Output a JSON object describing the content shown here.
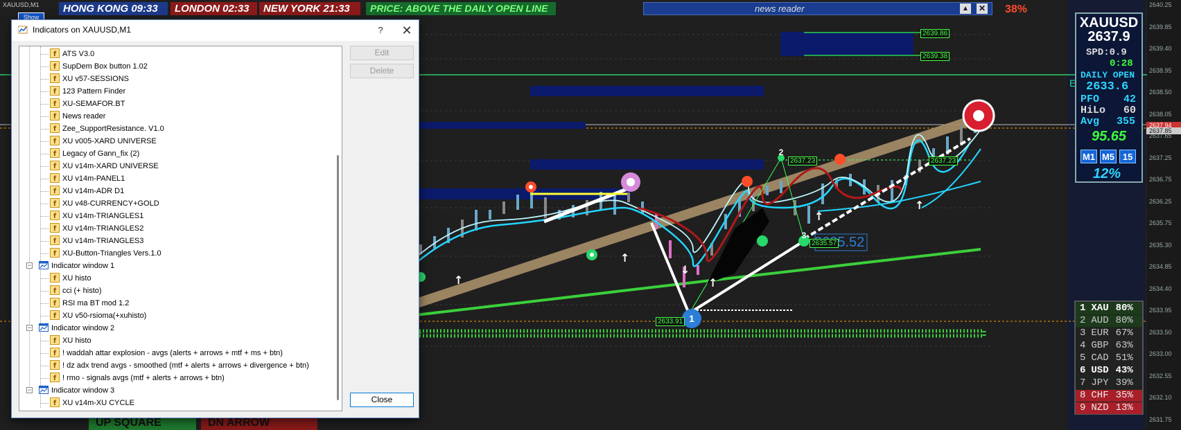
{
  "top_bar": {
    "symbol_tab": "XAUUSD,M1",
    "show_button": "Show",
    "clocks": [
      {
        "label": "HONG KONG 09:33"
      },
      {
        "label": "LONDON  02:33"
      },
      {
        "label": "NEW YORK 21:33"
      },
      {
        "label": "PRICE: ABOVE THE DAILY OPEN LINE"
      }
    ],
    "news_reader": "news reader",
    "news_up": "▲",
    "news_close": "✕",
    "percent": "38%"
  },
  "chart": {
    "price_ticks": [
      "2640.25",
      "2639.85",
      "2639.40",
      "2638.95",
      "2638.50",
      "2638.05",
      "2637.65",
      "2637.25",
      "2636.75",
      "2636.25",
      "2635.75",
      "2635.30",
      "2634.85",
      "2634.40",
      "2633.95",
      "2633.50",
      "2633.00",
      "2632.55",
      "2632.10",
      "2631.75"
    ],
    "current_price_tag": "2637.94",
    "bid_tag": "2637.85",
    "level_labels": [
      "2639.86",
      "2639.38",
      "2637.23",
      "2637.23",
      "2635.52",
      "2633.91",
      "2635.57"
    ],
    "wave_labels": [
      "1",
      "2",
      "3"
    ],
    "big_price_label": "2635.52"
  },
  "info_panel": {
    "symbol": "XAUUSD",
    "price": "2637.9",
    "spread": "SPD:0.9",
    "timer": "0:28",
    "daily_open_label": "DAILY OPEN",
    "daily_open": "2633.6",
    "pfo_label": "PFO",
    "pfo_value": "42",
    "hilo_label": "HiLo",
    "hilo_value": "60",
    "avg_label": "Avg",
    "avg_value": "355",
    "score": "95.65",
    "tf_buttons": [
      "M1",
      "M5",
      "15"
    ],
    "percent": "12%",
    "side_letter": "E"
  },
  "currency_strength": [
    {
      "rank": "1",
      "cur": "XAU",
      "pct": "80%",
      "color": "#ffffff",
      "bg": "#1d3a1d",
      "bold": true
    },
    {
      "rank": "2",
      "cur": "AUD",
      "pct": "80%",
      "color": "#cccccc",
      "bg": "#1d3a1d",
      "bold": false
    },
    {
      "rank": "3",
      "cur": "EUR",
      "pct": "67%",
      "color": "#cccccc",
      "bg": "#222222",
      "bold": false
    },
    {
      "rank": "4",
      "cur": "GBP",
      "pct": "63%",
      "color": "#cccccc",
      "bg": "#222222",
      "bold": false
    },
    {
      "rank": "5",
      "cur": "CAD",
      "pct": "51%",
      "color": "#cccccc",
      "bg": "#222222",
      "bold": false
    },
    {
      "rank": "6",
      "cur": "USD",
      "pct": "43%",
      "color": "#ffffff",
      "bg": "#222222",
      "bold": true
    },
    {
      "rank": "7",
      "cur": "JPY",
      "pct": "39%",
      "color": "#cccccc",
      "bg": "#222222",
      "bold": false
    },
    {
      "rank": "8",
      "cur": "CHF",
      "pct": "35%",
      "color": "#eeeeee",
      "bg": "#a81f2a",
      "bold": false
    },
    {
      "rank": "9",
      "cur": "NZD",
      "pct": "13%",
      "color": "#eeeeee",
      "bg": "#a81f2a",
      "bold": false
    }
  ],
  "dialog": {
    "title": "Indicators on XAUUSD,M1",
    "help": "?",
    "close": "✕",
    "buttons": {
      "edit": "Edit",
      "delete": "Delete",
      "close": "Close"
    },
    "tree": [
      {
        "label": "ATS V3.0",
        "level": 2,
        "type": "ind"
      },
      {
        "label": "SupDem Box button 1.02",
        "level": 2,
        "type": "ind"
      },
      {
        "label": "XU v57-SESSIONS",
        "level": 2,
        "type": "ind"
      },
      {
        "label": "123 Pattern Finder",
        "level": 2,
        "type": "ind"
      },
      {
        "label": "XU-SEMAFOR.BT",
        "level": 2,
        "type": "ind"
      },
      {
        "label": "News reader",
        "level": 2,
        "type": "ind"
      },
      {
        "label": "Zee_SupportResistance. V1.0",
        "level": 2,
        "type": "ind"
      },
      {
        "label": "XU v005-XARD UNIVERSE",
        "level": 2,
        "type": "ind"
      },
      {
        "label": "Legacy of Gann_fix (2)",
        "level": 2,
        "type": "ind"
      },
      {
        "label": "XU v14m-XARD UNIVERSE",
        "level": 2,
        "type": "ind"
      },
      {
        "label": "XU v14m-PANEL1",
        "level": 2,
        "type": "ind"
      },
      {
        "label": "XU v14m-ADR D1",
        "level": 2,
        "type": "ind"
      },
      {
        "label": "XU v48-CURRENCY+GOLD",
        "level": 2,
        "type": "ind"
      },
      {
        "label": "XU v14m-TRIANGLES1",
        "level": 2,
        "type": "ind"
      },
      {
        "label": "XU v14m-TRIANGLES2",
        "level": 2,
        "type": "ind"
      },
      {
        "label": "XU v14m-TRIANGLES3",
        "level": 2,
        "type": "ind"
      },
      {
        "label": "XU-Button-Triangles Vers.1.0",
        "level": 2,
        "type": "ind"
      },
      {
        "label": "Indicator window 1",
        "level": 1,
        "type": "win"
      },
      {
        "label": "XU histo",
        "level": 2,
        "type": "ind"
      },
      {
        "label": "cci (+ histo)",
        "level": 2,
        "type": "ind"
      },
      {
        "label": "RSI ma BT mod 1.2",
        "level": 2,
        "type": "ind"
      },
      {
        "label": "XU v50-rsioma(+xuhisto)",
        "level": 2,
        "type": "ind"
      },
      {
        "label": "Indicator window 2",
        "level": 1,
        "type": "win"
      },
      {
        "label": "XU histo",
        "level": 2,
        "type": "ind"
      },
      {
        "label": "! waddah attar explosion - avgs (alerts + arrows + mtf + ms + btn)",
        "level": 2,
        "type": "ind"
      },
      {
        "label": "! dz adx trend avgs - smoothed (mtf + alerts + arrows + divergence + btn)",
        "level": 2,
        "type": "ind"
      },
      {
        "label": "! rmo - signals avgs (mtf + alerts + arrows + btn)",
        "level": 2,
        "type": "ind"
      },
      {
        "label": "Indicator window 3",
        "level": 1,
        "type": "win"
      },
      {
        "label": "XU v14m-XU CYCLE",
        "level": 2,
        "type": "ind"
      }
    ]
  },
  "bottom_buttons": [
    "UP SQUARE",
    "DN ARROW"
  ]
}
